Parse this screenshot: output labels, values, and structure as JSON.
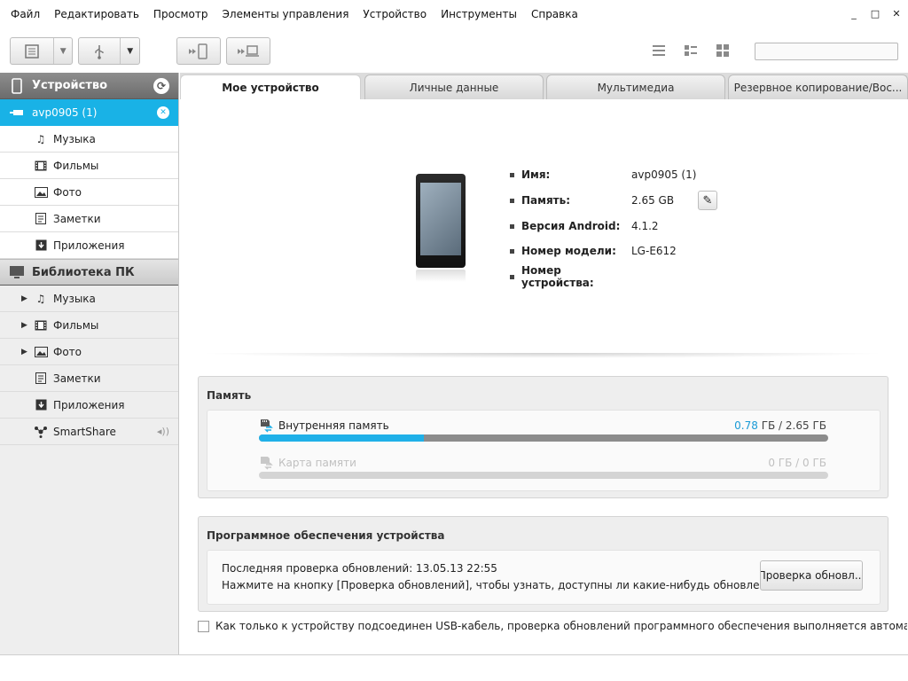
{
  "menu": {
    "items": [
      "Файл",
      "Редактировать",
      "Просмотр",
      "Элементы управления",
      "Устройство",
      "Инструменты",
      "Справка"
    ]
  },
  "window_controls": {
    "minimize": "_",
    "maximize": "□",
    "close": "✕"
  },
  "toolbar": {
    "search_value": ""
  },
  "sidebar": {
    "device_header": "Устройство",
    "device_name": "avp0905 (1)",
    "device_items": [
      {
        "label": "Музыка",
        "icon": "music-icon"
      },
      {
        "label": "Фильмы",
        "icon": "film-icon"
      },
      {
        "label": "Фото",
        "icon": "photo-icon"
      },
      {
        "label": "Заметки",
        "icon": "notes-icon"
      },
      {
        "label": "Приложения",
        "icon": "apps-icon"
      }
    ],
    "library_header": "Библиотека ПК",
    "library_items": [
      {
        "label": "Музыка",
        "icon": "music-icon"
      },
      {
        "label": "Фильмы",
        "icon": "film-icon"
      },
      {
        "label": "Фото",
        "icon": "photo-icon"
      },
      {
        "label": "Заметки",
        "icon": "notes-icon"
      },
      {
        "label": "Приложения",
        "icon": "apps-icon"
      },
      {
        "label": "SmartShare",
        "icon": "smartshare-icon"
      }
    ]
  },
  "tabs": [
    "Мое устройство",
    "Личные данные",
    "Мультимедиа",
    "Резервное копирование/Вос..."
  ],
  "device_info": {
    "name_label": "Имя:",
    "name_value": "avp0905 (1)",
    "memory_label": "Память:",
    "memory_value": "2.65 GB",
    "android_label": "Версия Android:",
    "android_value": "4.1.2",
    "model_label": "Номер модели:",
    "model_value": "LG-E612",
    "device_no_label": "Номер устройства:",
    "device_no_value": ""
  },
  "memory_panel": {
    "title": "Память",
    "internal_label": "Внутренняя память",
    "internal_used": "0.78",
    "internal_rest": " ГБ / 2.65 ГБ",
    "internal_fraction": 0.29,
    "card_label": "Карта памяти",
    "card_value": "0 ГБ / 0 ГБ",
    "card_fraction": 0
  },
  "software_panel": {
    "title": "Программное обеспечения устройства",
    "last_check": "Последняя проверка обновлений: 13.05.13 22:55",
    "hint": "Нажмите на кнопку [Проверка обновлений], чтобы узнать, доступны ли какие-нибудь обновления.",
    "check_button": "Проверка обновл..."
  },
  "auto_check_label": "Как только к устройству подсоединен USB-кабель, проверка обновлений программного обеспечения выполняется автоматически",
  "colors": {
    "accent": "#19b2e6",
    "used_value": "#1a9ad6"
  }
}
